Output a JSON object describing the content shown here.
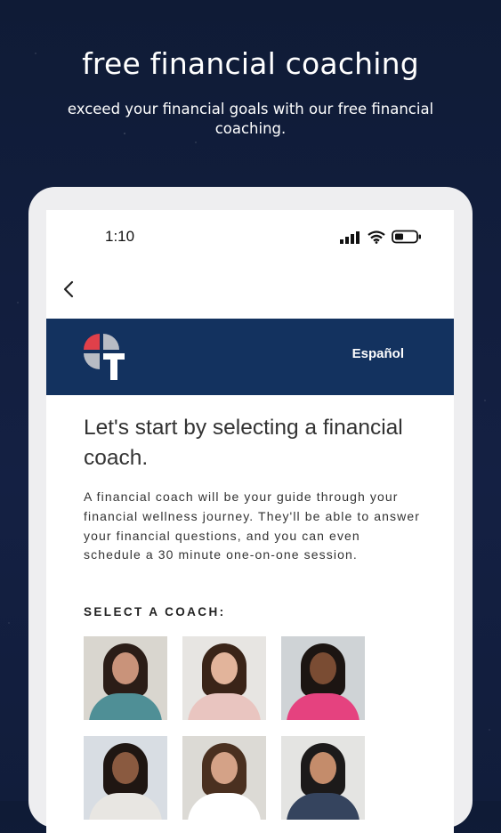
{
  "promo": {
    "headline": "free financial coaching",
    "subhead": "exceed your financial goals with our free financial coaching."
  },
  "status_bar": {
    "time": "1:10",
    "icons": [
      "signal-icon",
      "wifi-icon",
      "battery-icon"
    ]
  },
  "nav": {
    "back_icon": "chevron-left-icon"
  },
  "header": {
    "logo": "t-logo",
    "language_link": "Español",
    "brand_color": "#13325f",
    "logo_red": "#e0404a",
    "logo_gray": "#b8bcc4"
  },
  "content": {
    "title": "Let's start by selecting a financial coach.",
    "description": "A financial coach will be your guide through your financial wellness journey. They'll be able to answer your financial questions, and you can even schedule a 30 minute one-on-one session.",
    "section_label": "SELECT A COACH:"
  },
  "coaches": [
    {
      "icon": "coach-photo",
      "bg": "#d9d6cf",
      "hair": "#2b1d17",
      "skin": "#c9937a",
      "top": "#4f8f96"
    },
    {
      "icon": "coach-photo",
      "bg": "#e7e5e2",
      "hair": "#3a2418",
      "skin": "#e2b49b",
      "top": "#e9c5c0"
    },
    {
      "icon": "coach-photo",
      "bg": "#cfd3d6",
      "hair": "#1c1512",
      "skin": "#7a4c33",
      "top": "#e5427f"
    },
    {
      "icon": "coach-photo",
      "bg": "#d8dde3",
      "hair": "#1f1612",
      "skin": "#8a5a40",
      "top": "#e8e6e2"
    },
    {
      "icon": "coach-photo",
      "bg": "#dcdad5",
      "hair": "#4a3020",
      "skin": "#d4a287",
      "top": "#ffffff"
    },
    {
      "icon": "coach-photo",
      "bg": "#e4e4e2",
      "hair": "#1c1a1a",
      "skin": "#c48c6b",
      "top": "#35445e"
    }
  ]
}
